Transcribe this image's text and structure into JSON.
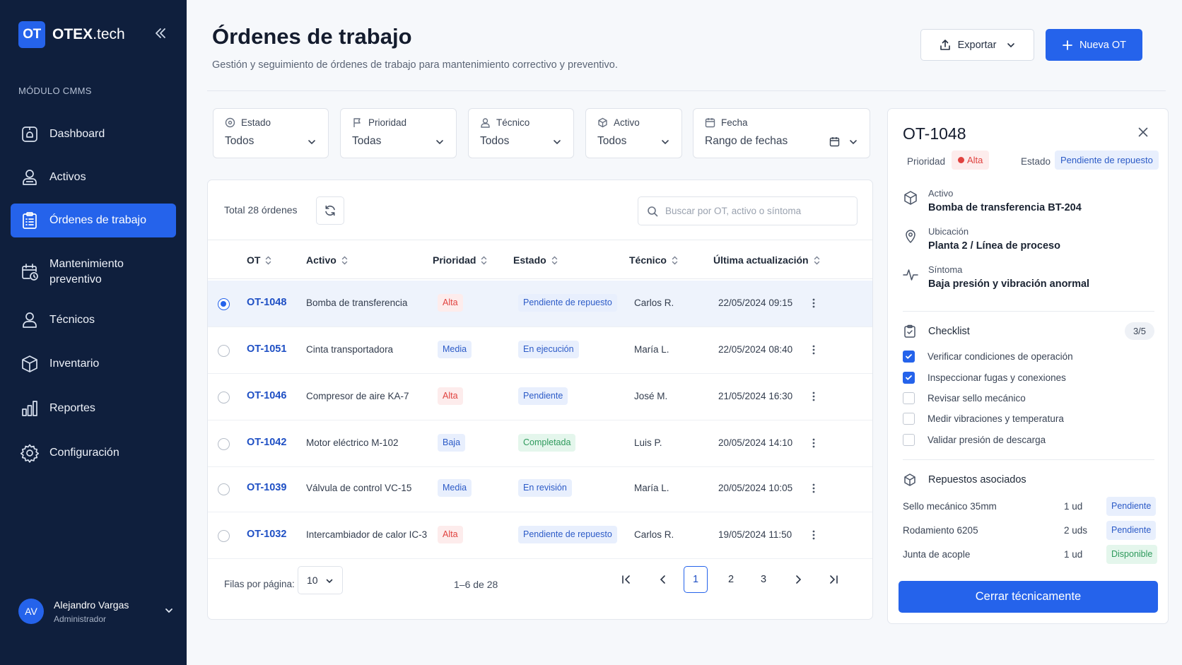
{
  "sidebar": {
    "logo": "OT",
    "brand_main": "OTEX",
    "brand_suffix": ".tech",
    "section": "MÓDULO CMMS",
    "items": [
      {
        "label": "Dashboard",
        "icon": "dashboard-icon"
      },
      {
        "label": "Activos",
        "icon": "assets-icon"
      },
      {
        "label": "Órdenes de trabajo",
        "icon": "clipboard-icon",
        "active": true
      },
      {
        "label": "Mantenimiento preventivo",
        "icon": "calendar-clock-icon"
      },
      {
        "label": "Técnicos",
        "icon": "user-icon"
      },
      {
        "label": "Inventario",
        "icon": "box-icon"
      },
      {
        "label": "Reportes",
        "icon": "bar-chart-icon"
      },
      {
        "label": "Configuración",
        "icon": "gear-icon"
      }
    ],
    "user": {
      "initials": "AV",
      "name": "Alejandro Vargas",
      "role": "Administrador"
    }
  },
  "header": {
    "title": "Órdenes de trabajo",
    "subtitle": "Gestión y seguimiento de órdenes de trabajo para mantenimiento correctivo y preventivo.",
    "export_label": "Exportar",
    "new_label": "Nueva OT"
  },
  "filters": [
    {
      "label": "Estado",
      "value": "Todos"
    },
    {
      "label": "Prioridad",
      "value": "Todas"
    },
    {
      "label": "Técnico",
      "value": "Todos"
    },
    {
      "label": "Activo",
      "value": "Todos"
    },
    {
      "label": "Fecha",
      "value": "Rango de fechas"
    }
  ],
  "table": {
    "total_label": "Total 28 órdenes",
    "search_placeholder": "Buscar por OT, activo o síntoma",
    "columns": [
      "OT",
      "Activo",
      "Prioridad",
      "Estado",
      "Técnico",
      "Última actualización"
    ],
    "rows": [
      {
        "ot": "OT-1048",
        "activo": "Bomba de transferencia",
        "prioridad": "Alta",
        "estado": "Pendiente de repuesto",
        "tecnico": "Carlos R.",
        "fecha": "22/05/2024 09:15",
        "selected": true
      },
      {
        "ot": "OT-1051",
        "activo": "Cinta transportadora",
        "prioridad": "Media",
        "estado": "En ejecución",
        "tecnico": "María L.",
        "fecha": "22/05/2024 08:40"
      },
      {
        "ot": "OT-1046",
        "activo": "Compresor de aire KA-7",
        "prioridad": "Alta",
        "estado": "Pendiente",
        "tecnico": "José M.",
        "fecha": "21/05/2024 16:30"
      },
      {
        "ot": "OT-1042",
        "activo": "Motor eléctrico M-102",
        "prioridad": "Baja",
        "estado": "Completada",
        "tecnico": "Luis P.",
        "fecha": "20/05/2024 14:10"
      },
      {
        "ot": "OT-1039",
        "activo": "Válvula de control VC-15",
        "prioridad": "Media",
        "estado": "En revisión",
        "tecnico": "María L.",
        "fecha": "20/05/2024 10:05"
      },
      {
        "ot": "OT-1032",
        "activo": "Intercambiador de calor IC-3",
        "prioridad": "Alta",
        "estado": "Pendiente de repuesto",
        "tecnico": "Carlos R.",
        "fecha": "19/05/2024 11:50"
      }
    ],
    "rows_per_page_label": "Filas por página:",
    "rows_per_page": "10",
    "range": "1–6 de 28",
    "pages": [
      "1",
      "2",
      "3"
    ],
    "current_page": "1"
  },
  "detail": {
    "title": "OT-1048",
    "priority_label": "Prioridad",
    "priority": "Alta",
    "status_label": "Estado",
    "status": "Pendiente de repuesto",
    "asset_label": "Activo",
    "asset": "Bomba de transferencia BT-204",
    "location_label": "Ubicación",
    "location": "Planta 2 / Línea de proceso",
    "symptom_label": "Síntoma",
    "symptom": "Baja presión y vibración anormal",
    "checklist_label": "Checklist",
    "checklist_count": "3/5",
    "checklist": [
      {
        "label": "Verificar condiciones de operación",
        "checked": true
      },
      {
        "label": "Inspeccionar fugas y conexiones",
        "checked": true
      },
      {
        "label": "Revisar sello mecánico",
        "checked": false
      },
      {
        "label": "Medir vibraciones y temperatura",
        "checked": false
      },
      {
        "label": "Validar presión de descarga",
        "checked": false
      }
    ],
    "parts_label": "Repuestos asociados",
    "parts": [
      {
        "name": "Sello mecánico 35mm",
        "qty": "1 ud",
        "status": "Pendiente"
      },
      {
        "name": "Rodamiento 6205",
        "qty": "2 uds",
        "status": "Pendiente"
      },
      {
        "name": "Junta de acople",
        "qty": "1 ud",
        "status": "Disponible"
      }
    ],
    "action_label": "Cerrar técnicamente"
  }
}
